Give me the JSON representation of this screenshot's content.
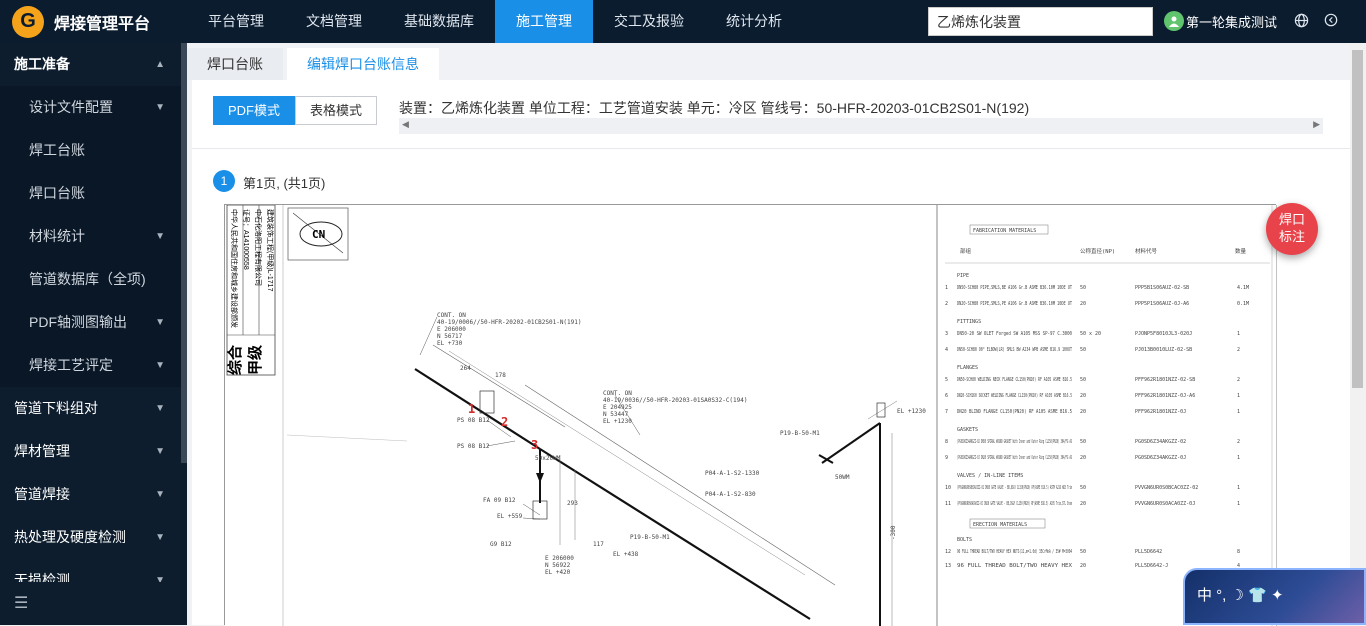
{
  "app": {
    "logo_char": "G",
    "title": "焊接管理平台"
  },
  "nav": [
    {
      "label": "平台管理",
      "active": false
    },
    {
      "label": "文档管理",
      "active": false
    },
    {
      "label": "基础数据库",
      "active": false
    },
    {
      "label": "施工管理",
      "active": true
    },
    {
      "label": "交工及报验",
      "active": false
    },
    {
      "label": "统计分析",
      "active": false
    }
  ],
  "search": {
    "value": "乙烯炼化装置"
  },
  "user": {
    "name": "第一轮集成测试"
  },
  "icons": {
    "globe": "globe-icon",
    "logout": "logout-icon"
  },
  "sidebar": {
    "group_open": "施工准备",
    "sub_items": [
      {
        "label": "设计文件配置",
        "chevron": true
      },
      {
        "label": "焊工台账",
        "chevron": false
      },
      {
        "label": "焊口台账",
        "chevron": false
      },
      {
        "label": "材料统计",
        "chevron": true
      },
      {
        "label": "管道数据库（全项)",
        "chevron": false
      },
      {
        "label": "PDF轴测图输出",
        "chevron": true
      },
      {
        "label": "焊接工艺评定",
        "chevron": true
      }
    ],
    "groups": [
      "管道下料组对",
      "焊材管理",
      "管道焊接",
      "热处理及硬度检测",
      "无损检测"
    ]
  },
  "tabs": [
    {
      "label": "焊口台账",
      "active": false
    },
    {
      "label": "编辑焊口台账信息",
      "active": true
    }
  ],
  "modes": [
    {
      "label": "PDF模式",
      "active": true
    },
    {
      "label": "表格模式",
      "active": false
    }
  ],
  "info_line": "装置：乙烯炼化装置 单位工程：工艺管道安装 单元：冷区 管线号：50-HFR-20203-01CB2S01-N(192)",
  "pager": {
    "page_num": "1",
    "page_text": "第1页, (共1页)"
  },
  "weld_button": {
    "line1": "焊口",
    "line2": "标注"
  },
  "ime": {
    "text": "中 °, ☽ 👕 ✦"
  },
  "drawing": {
    "cert_lines": [
      "中华人民共和国住房和城乡建设部颁发",
      "证号：A141000558",
      "中石化洛阳工程有限公司",
      "建筑装饰工程(甲级)L-1717"
    ],
    "stamp_main": "综合",
    "stamp_sub": "甲级",
    "north": "CN",
    "weld_numbers": [
      "1",
      "2",
      "3"
    ],
    "callouts": [
      "CONT. ON",
      "40-19/0006//50-HFR-20202-01CB2S01-N(191)",
      "E 206000",
      "N 56717",
      "EL +730",
      "CONT. ON",
      "40-19/0036//50-HFR-20203-01SA0S32-C(194)",
      "E 204925",
      "N 53447",
      "EL +1230",
      "P19-B-50-M1",
      "P19-B-50-M1",
      "P04-A-1-S2-830",
      "P04-A-1-S2-1330",
      "50WM",
      "50x20WM",
      "EL +559",
      "EL +438",
      "E 206000",
      "N 56922",
      "EL +420",
      "PS 08 B12",
      "PS 08 B12",
      "FA 09 B12",
      "G9 B12",
      "117",
      "293",
      "178",
      "264",
      "EL +1230",
      "-300"
    ],
    "materials_title": "FABRICATION MATERIALS",
    "erection_title": "ERECTION MATERIALS",
    "columns": [
      "部组",
      "公称直径(NP)",
      "材料代号",
      "数量"
    ],
    "sections": [
      {
        "name": "PIPE",
        "rows": [
          {
            "no": "1",
            "desc": "DN50-SCH80 PIPE,SMLS,BE A106 Gr.B ASME B36.10M 10DE UT",
            "size": "50",
            "code": "PPP5B1S06AUZ-02-SB",
            "qty": "4.1M"
          },
          {
            "no": "2",
            "desc": "DN20-SCH80 PIPE,SMLS,PE A106 Gr.B ASME B36.10M 10DE UT",
            "size": "20",
            "code": "PPP5P1S06AUZ-0J-A6",
            "qty": "0.1M"
          }
        ]
      },
      {
        "name": "FITTINGS",
        "rows": [
          {
            "no": "3",
            "desc": "DN50-20 SW OLET Forged SW A105 MSS SP-97 C.3000",
            "size": "50 x 20",
            "code": "PJONP5F8010JL3-020J",
            "qty": "1"
          },
          {
            "no": "4",
            "desc": "DN50-SCH80 90° ELBOW(LR) SMLS BW A234 WPB ASME B16.9 100UT",
            "size": "50",
            "code": "PJ013B0010LUZ-02-SB",
            "qty": "2"
          }
        ]
      },
      {
        "name": "FLANGES",
        "rows": [
          {
            "no": "5",
            "desc": "DN50-SCH80 WELDING NECK FLANGE CL150(PN20) RF A105 ASME B16.5",
            "size": "50",
            "code": "PFF962R1801NZZ-02-SB",
            "qty": "2"
          },
          {
            "no": "6",
            "desc": "DN20-SCH160 SOCKET WELDING FLANGE CL150(PN20) RF A105 ASME B16.5",
            "size": "20",
            "code": "PFF962R1801NZZ-0J-A6",
            "qty": "1"
          },
          {
            "no": "7",
            "desc": "DN20 BLIND FLANGE CL150(PN20) RF A105 ASME B16.5",
            "size": "20",
            "code": "PFF962R1801NZZ-0J",
            "qty": "1"
          }
        ]
      },
      {
        "name": "GASKETS",
        "rows": [
          {
            "no": "8",
            "desc": "/PG0SD6Z34AKGZZ-02 DN50 SPIRAL WOUND GASKET With Inner and Outer Ring CL150(PN20) 304/FG AS",
            "size": "50",
            "code": "PG0SD6Z34AKGZZ-02",
            "qty": "2"
          },
          {
            "no": "9",
            "desc": "/PG0SD6Z34AKGZZ-0J DN20 SPIRAL WOUND GASKET With Inner and Outer Ring CL150(PN20) 304/FG AS",
            "size": "20",
            "code": "PG0SD6Z34AKGZZ-0J",
            "qty": "1"
          }
        ]
      },
      {
        "name": "VALVES / IN-LINE ITEMS",
        "rows": [
          {
            "no": "10",
            "desc": "/PVVGN6UR0S0BCAC0ZZ-02 DN50 GATE VALVE - BB,OS&Y CL150(PN20) RF(ASME B16.5) ASTM A216 WCB Trim",
            "size": "50",
            "code": "PVVGN6UR0S0BCAC0ZZ-02",
            "qty": "1"
          },
          {
            "no": "11",
            "desc": "/PVVGN6UR0S0ACA0ZZ-0J DN20 GATE VALVE - BB,OS&Y CL150(PN20) RF(ASME B16.5) A105 Trim,STL Stem",
            "size": "20",
            "code": "PVVGN6UR0S0ACA0ZZ-0J",
            "qty": "1"
          }
        ]
      }
    ],
    "bolts_name": "BOLTS",
    "bolt_rows": [
      {
        "no": "12",
        "desc": "96 FULL THREAD BOLT/TWO HEAVY HEX NUTS(11,m=1.0d) 35CrMoA / 35# M=3004",
        "size": "50",
        "code": "PLL5D6642",
        "qty": "8"
      },
      {
        "no": "13",
        "desc": "96 FULL THREAD BOLT/TWO HEAVY HEX",
        "size": "20",
        "code": "PLL5D6642-J",
        "qty": "4"
      }
    ]
  }
}
